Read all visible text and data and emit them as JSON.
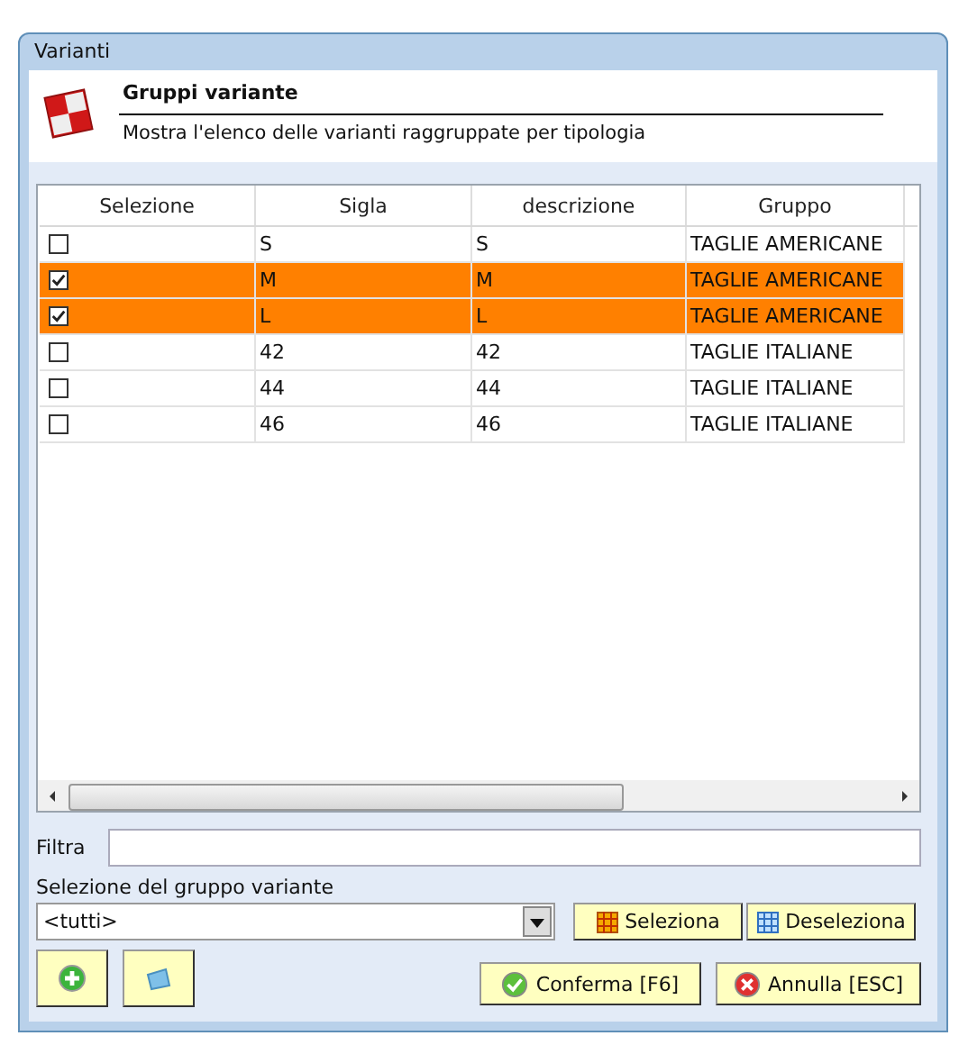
{
  "window": {
    "title": "Varianti"
  },
  "header": {
    "title": "Gruppi variante",
    "subtitle": "Mostra l'elenco delle varianti raggruppate per tipologia"
  },
  "table": {
    "columns": [
      "Selezione",
      "Sigla",
      "descrizione",
      "Gruppo"
    ],
    "rows": [
      {
        "checked": false,
        "selected": false,
        "sigla": "S",
        "descrizione": "S",
        "gruppo": "TAGLIE AMERICANE"
      },
      {
        "checked": true,
        "selected": true,
        "sigla": "M",
        "descrizione": "M",
        "gruppo": "TAGLIE AMERICANE"
      },
      {
        "checked": true,
        "selected": true,
        "sigla": "L",
        "descrizione": "L",
        "gruppo": "TAGLIE AMERICANE"
      },
      {
        "checked": false,
        "selected": false,
        "sigla": "42",
        "descrizione": "42",
        "gruppo": "TAGLIE ITALIANE"
      },
      {
        "checked": false,
        "selected": false,
        "sigla": "44",
        "descrizione": "44",
        "gruppo": "TAGLIE ITALIANE"
      },
      {
        "checked": false,
        "selected": false,
        "sigla": "46",
        "descrizione": "46",
        "gruppo": "TAGLIE ITALIANE"
      }
    ]
  },
  "filter": {
    "label": "Filtra"
  },
  "group_select": {
    "label": "Selezione del gruppo variante",
    "value": "<tutti>"
  },
  "buttons": {
    "select": "Seleziona",
    "deselect": "Deseleziona",
    "confirm": "Conferma [F6]",
    "cancel": "Annulla [ESC]"
  }
}
